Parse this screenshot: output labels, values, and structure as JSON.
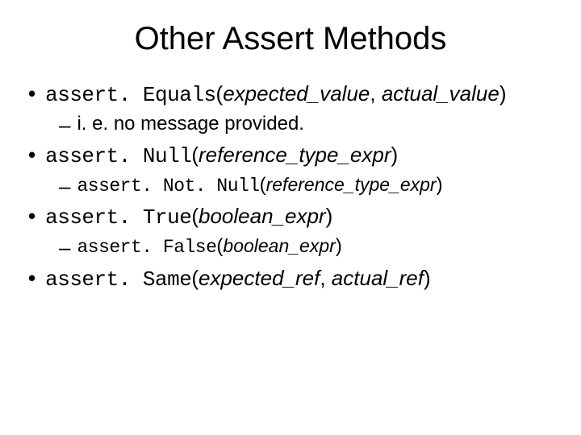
{
  "title": "Other Assert Methods",
  "b1": {
    "m": "assert. Equals",
    "p1": "(",
    "a1": "expected_value",
    "c": ", ",
    "a2": "actual_value",
    "p2": ")"
  },
  "b1s": "i. e. no message provided.",
  "b2": {
    "m": "assert. Null",
    "p1": "(",
    "a": "reference_type_expr",
    "p2": ")"
  },
  "b2s": {
    "m": "assert. Not. Null",
    "p1": "(",
    "a": "reference_type_expr",
    "p2": ")"
  },
  "b3": {
    "m": "assert. True",
    "p1": "(",
    "a": "boolean_expr",
    "p2": ")"
  },
  "b3s": {
    "m": "assert. False",
    "p1": "(",
    "a": "boolean_expr",
    "p2": ")"
  },
  "b4": {
    "m": "assert. Same",
    "p1": "(",
    "a1": "expected_ref",
    "c": ", ",
    "a2": "actual_ref",
    "p2": ")"
  }
}
